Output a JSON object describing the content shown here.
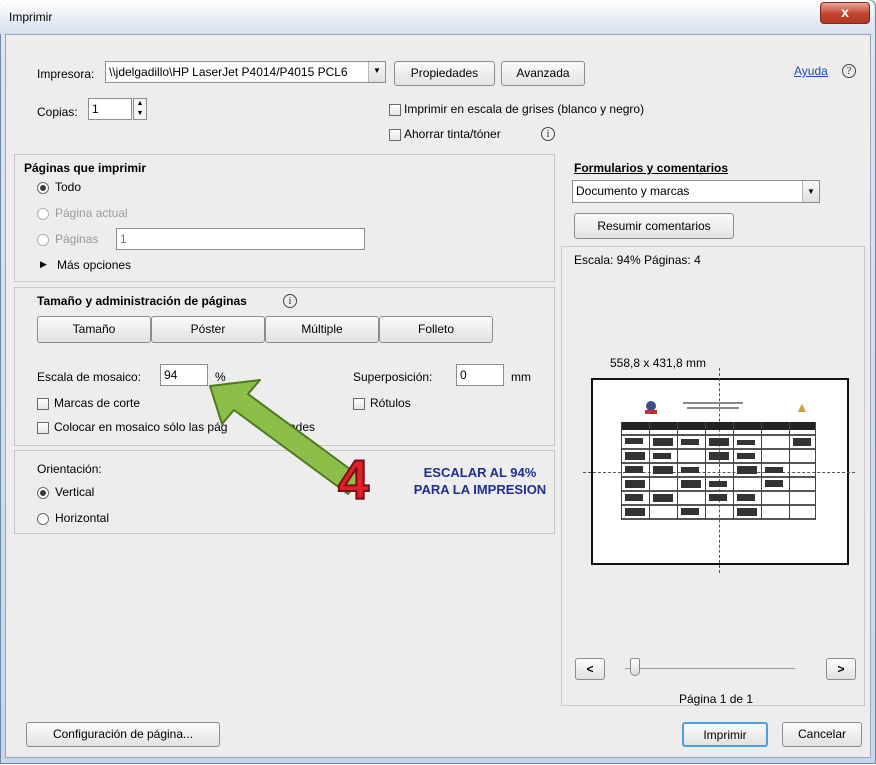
{
  "window": {
    "title": "Imprimir",
    "close_glyph": "x"
  },
  "printer": {
    "label": "Impresora:",
    "value": "\\\\jdelgadillo\\HP LaserJet P4014/P4015 PCL6",
    "properties_button": "Propiedades",
    "advanced_button": "Avanzada",
    "help_link": "Ayuda",
    "help_icon": "help-circle-icon"
  },
  "copies": {
    "label": "Copias:",
    "value": "1"
  },
  "options": {
    "grayscale": "Imprimir en escala de grises (blanco y negro)",
    "save_ink": "Ahorrar tinta/tóner"
  },
  "pages": {
    "header": "Páginas que imprimir",
    "all": "Todo",
    "current": "Página actual",
    "pages_label": "Páginas",
    "pages_value": "1",
    "more": "Más opciones"
  },
  "sizing": {
    "header": "Tamaño y administración de páginas",
    "buttons": [
      "Tamaño",
      "Póster",
      "Múltiple",
      "Folleto"
    ],
    "tile_scale_label": "Escala de mosaico:",
    "tile_scale_value": "94",
    "tile_scale_unit": "%",
    "overlap_label": "Superposición:",
    "overlap_value": "0",
    "overlap_unit": "mm",
    "cut_marks": "Marcas de corte",
    "labels": "Rótulos",
    "tile_only_text": "Colocar en mosaico sólo las pág",
    "tile_only_tail": "ades"
  },
  "orientation": {
    "header": "Orientación:",
    "portrait": "Vertical",
    "landscape": "Horizontal"
  },
  "annotation": {
    "number": "4",
    "line1": "ESCALAR AL 94%",
    "line2": "PARA LA IMPRESION",
    "arrow_color": "#8cbf4a",
    "number_color": "#e0202a",
    "text_color": "#1f2f8f"
  },
  "forms": {
    "header": "Formularios y comentarios",
    "select_value": "Documento y marcas",
    "summarize_button": "Resumir comentarios"
  },
  "preview": {
    "scale_text": "Escala: 94% Páginas: 4",
    "size_text": "558,8 x 431,8 mm",
    "page_text": "Página 1 de 1",
    "prev": "<",
    "next": ">"
  },
  "footer": {
    "page_setup": "Configuración de página...",
    "print": "Imprimir",
    "cancel": "Cancelar"
  }
}
